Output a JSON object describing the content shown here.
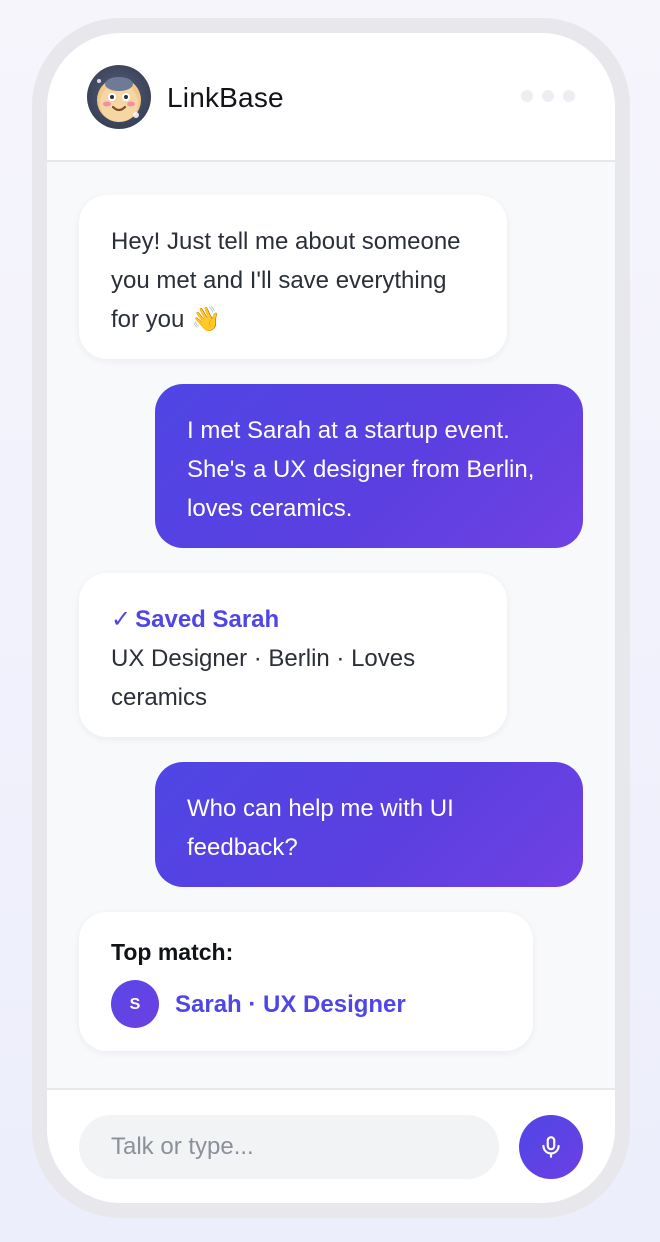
{
  "header": {
    "app_title": "LinkBase",
    "avatar_icon": "smiling-mascot-icon",
    "menu_icon": "more-dots-icon"
  },
  "messages": [
    {
      "from": "bot",
      "text": "Hey! Just tell me about someone you met and I'll save everything for you 👋"
    },
    {
      "from": "user",
      "text": "I met Sarah at a startup event. She's a UX designer from Berlin, loves ceramics."
    },
    {
      "from": "bot",
      "check": "✓",
      "title": "Saved Sarah",
      "text": "UX Designer · Berlin · Loves ceramics"
    },
    {
      "from": "user",
      "text": "Who can help me with UI feedback?"
    },
    {
      "from": "bot",
      "label": "Top match:",
      "avatar_initial": "S",
      "match": "Sarah · UX Designer"
    }
  ],
  "composer": {
    "placeholder": "Talk or type...",
    "value": "",
    "mic_icon": "microphone-icon"
  },
  "colors": {
    "accent": "#4f46e5",
    "accent_end": "#7041e4",
    "bot_bubble": "#ffffff",
    "screen_bg": "#f8f9fb"
  }
}
